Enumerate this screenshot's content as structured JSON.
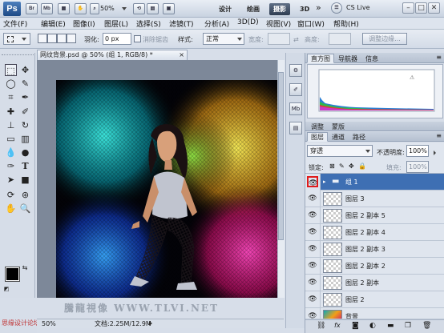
{
  "app": {
    "logo": "Ps",
    "zoom": "50%",
    "cs_live": "CS Live"
  },
  "icons": {
    "bridge": "Br",
    "mini_bridge": "Mb"
  },
  "workspaces": [
    {
      "label": "设计",
      "active": false
    },
    {
      "label": "绘画",
      "active": false
    },
    {
      "label": "摄影",
      "active": true
    },
    {
      "label": "3D",
      "active": false
    }
  ],
  "menu": [
    "文件(F)",
    "编辑(E)",
    "图像(I)",
    "图层(L)",
    "选择(S)",
    "滤镜(T)",
    "分析(A)",
    "3D(D)",
    "视图(V)",
    "窗口(W)",
    "帮助(H)"
  ],
  "options": {
    "feather_label": "羽化:",
    "feather_value": "0 px",
    "antialias_label": "消除锯齿",
    "style_label": "样式:",
    "style_value": "正常",
    "width_label": "宽度:",
    "height_label": "高度:",
    "refine_edge": "调整边缘..."
  },
  "document": {
    "tab_title": "网纹背景.psd @ 50% (组 1, RGB/8) *",
    "zoom": "50%",
    "doc_size": "文档:2.25M/12.9M"
  },
  "panels": {
    "top_tabs": [
      {
        "label": "直方图",
        "active": true
      },
      {
        "label": "导航器",
        "active": false
      },
      {
        "label": "信息",
        "active": false
      }
    ],
    "mid_tabs": [
      {
        "label": "调整",
        "active": false
      },
      {
        "label": "蒙版",
        "active": false
      }
    ],
    "layer_tabs": [
      {
        "label": "图层",
        "active": true
      },
      {
        "label": "通道",
        "active": false
      },
      {
        "label": "路径",
        "active": false
      }
    ]
  },
  "layers": {
    "blend_mode": "穿透",
    "opacity_label": "不透明度:",
    "opacity_value": "100%",
    "lock_label": "锁定:",
    "fill_label": "填充:",
    "fill_value": "100%",
    "rows": [
      {
        "name": "组 1",
        "group": true,
        "selected": true
      },
      {
        "name": "图层 3",
        "group": false,
        "selected": false
      },
      {
        "name": "图层 2 副本 5",
        "group": false,
        "selected": false
      },
      {
        "name": "图层 2 副本 4",
        "group": false,
        "selected": false
      },
      {
        "name": "图层 2 副本 3",
        "group": false,
        "selected": false
      },
      {
        "name": "图层 2 副本 2",
        "group": false,
        "selected": false
      },
      {
        "name": "图层 2 副本",
        "group": false,
        "selected": false
      },
      {
        "name": "图层 2",
        "group": false,
        "selected": false
      },
      {
        "name": "背景",
        "group": false,
        "selected": false
      }
    ]
  },
  "watermark": "騰龍視像 WWW.TLVI.NET",
  "bottom_logo": "思缘设计论坛",
  "colors": {
    "selected_row": "#3e6fb3",
    "highlight_border": "#e01b1b"
  }
}
